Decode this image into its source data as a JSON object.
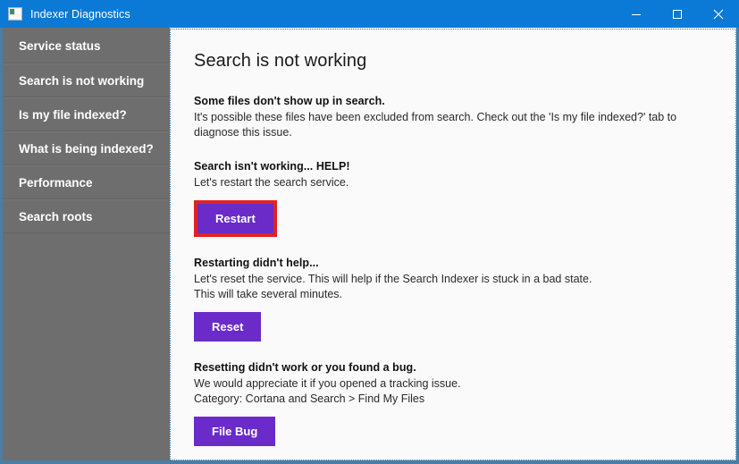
{
  "window": {
    "title": "Indexer Diagnostics",
    "icon": "app-icon",
    "controls": {
      "minimize": "minimize-icon",
      "maximize": "maximize-icon",
      "close": "close-icon"
    }
  },
  "colors": {
    "titlebar": "#0a7ad6",
    "sidebar": "#6e6e6e",
    "content_bg": "#fafafa",
    "accent_button": "#6a2bc9",
    "highlight_ring": "#e02222",
    "frame": "#4a7ea4"
  },
  "sidebar": {
    "items": [
      {
        "label": "Service status"
      },
      {
        "label": "Search is not working"
      },
      {
        "label": "Is my file indexed?"
      },
      {
        "label": "What is being indexed?"
      },
      {
        "label": "Performance"
      },
      {
        "label": "Search roots"
      }
    ]
  },
  "main": {
    "title": "Search is not working",
    "sections": [
      {
        "heading": "Some files don't show up in search.",
        "lines": [
          "It's possible these files have been excluded from search. Check out the 'Is my file indexed?' tab to diagnose this issue."
        ],
        "button": null
      },
      {
        "heading": "Search isn't working... HELP!",
        "lines": [
          "Let's restart the search service."
        ],
        "button": "Restart"
      },
      {
        "heading": "Restarting didn't help...",
        "lines": [
          "Let's reset the service. This will help if the Search Indexer is stuck in a bad state.",
          "This will take several minutes."
        ],
        "button": "Reset"
      },
      {
        "heading": "Resetting didn't work or you found a bug.",
        "lines": [
          "We would appreciate it if you opened a tracking issue.",
          "Category: Cortana and Search > Find My Files"
        ],
        "button": "File Bug"
      }
    ]
  }
}
